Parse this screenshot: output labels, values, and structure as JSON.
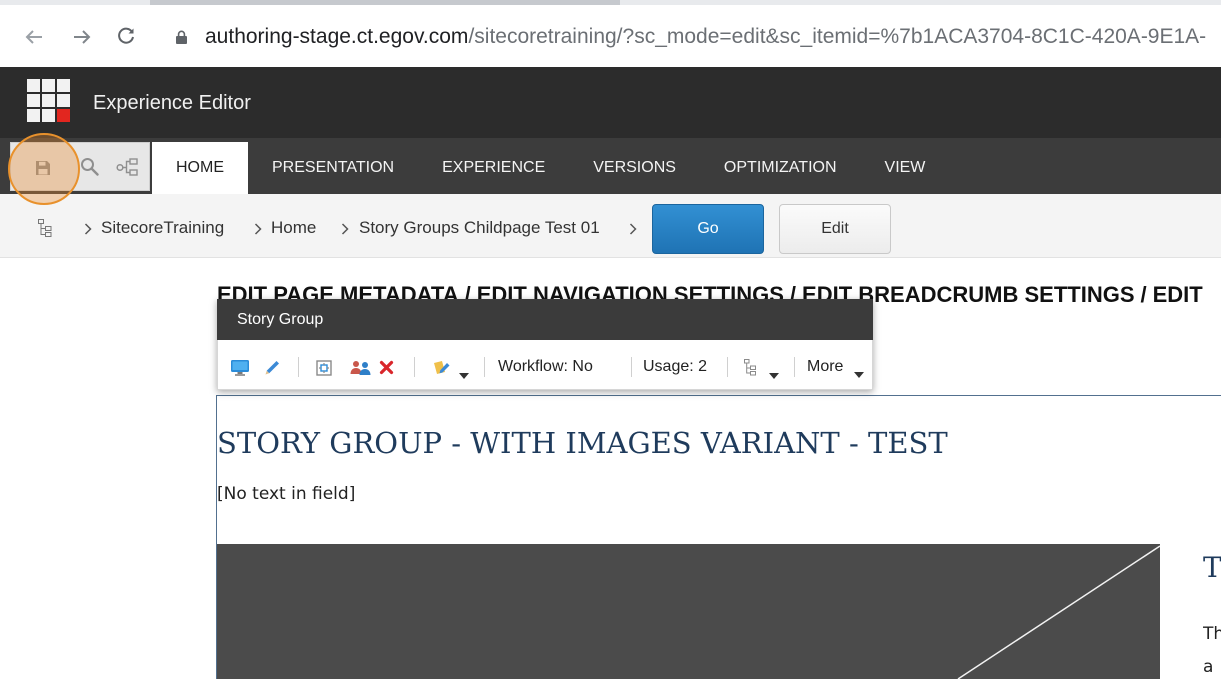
{
  "browser": {
    "url_host": "authoring-stage.ct.egov.com",
    "url_rest": "/sitecoretraining/?sc_mode=edit&sc_itemid=%7b1ACA3704-8C1C-420A-9E1A-",
    "icons": [
      "back-arrow-icon",
      "forward-arrow-icon",
      "reload-icon",
      "lock-icon"
    ]
  },
  "app": {
    "title": "Experience Editor",
    "logo_icon": "launchpad-grid-icon"
  },
  "quick_access": {
    "icons": [
      "save-icon",
      "search-icon",
      "navigate-tree-icon"
    ]
  },
  "ribbon": {
    "tabs": [
      {
        "label": "HOME",
        "active": true
      },
      {
        "label": "PRESENTATION",
        "active": false
      },
      {
        "label": "EXPERIENCE",
        "active": false
      },
      {
        "label": "VERSIONS",
        "active": false
      },
      {
        "label": "OPTIMIZATION",
        "active": false
      },
      {
        "label": "VIEW",
        "active": false
      }
    ]
  },
  "breadcrumb": {
    "items": [
      "SitecoreTraining",
      "Home",
      "Story Groups Childpage Test 01"
    ],
    "go_label": "Go",
    "edit_label": "Edit"
  },
  "page": {
    "metadata_links": [
      "EDIT PAGE METADATA",
      "EDIT NAVIGATION SETTINGS",
      "EDIT BREADCRUMB SETTINGS",
      "EDIT"
    ],
    "link_separator": "/",
    "heading": "STORY GROUP - WITH IMAGES VARIANT - TEST",
    "empty_field": "[No text in field]",
    "side_heading_fragment": "T",
    "side_text_lines": [
      "Th",
      "a"
    ]
  },
  "component_toolbar": {
    "title": "Story Group",
    "workflow_label": "Workflow: No",
    "usage_label": "Usage: 2",
    "more_label": "More",
    "icons": [
      "preview-monitor-icon",
      "edit-pencil-icon",
      "insert-item-icon",
      "personalize-people-icon",
      "delete-icon",
      "edit-related-icon",
      "tree-structure-icon",
      "chevron-down-icon"
    ]
  },
  "colors": {
    "header_bg": "#2c2c2c",
    "ribbon_bg": "#3c3c3c",
    "accent_blue": "#2a84c8",
    "heading_navy": "#1f3b5c",
    "delete_red": "#d9262b",
    "highlight_orange": "#e8912c"
  }
}
